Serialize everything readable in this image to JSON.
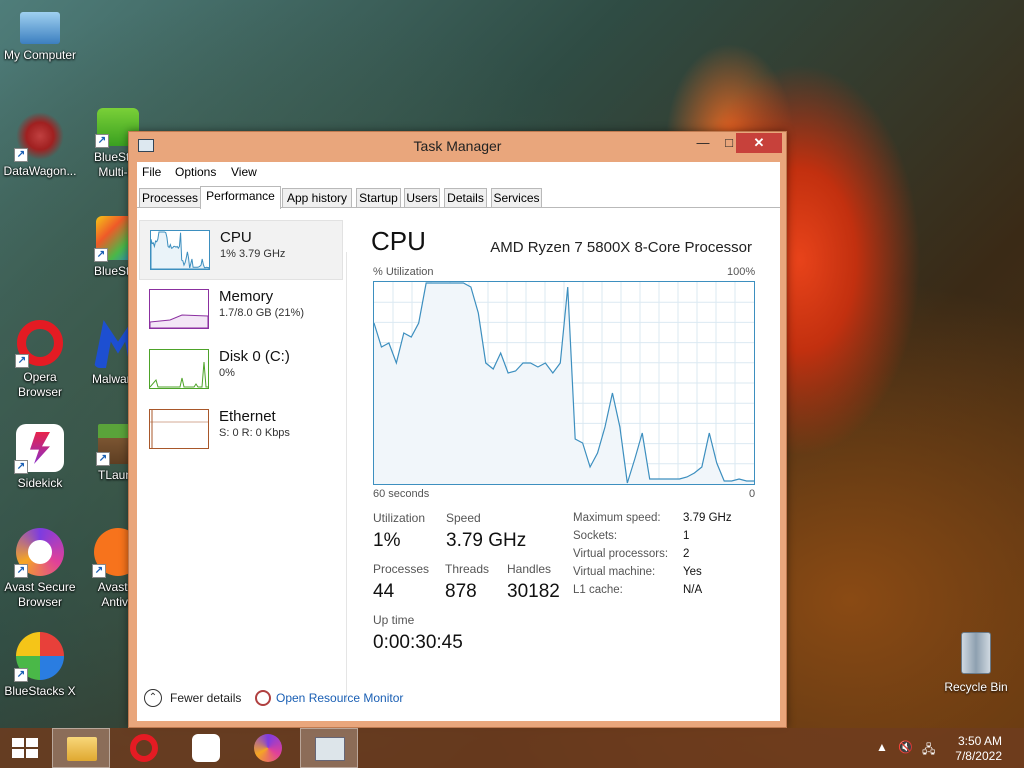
{
  "desktop": {
    "icons": [
      {
        "label1": "My Computer",
        "label2": ""
      },
      {
        "label1": "DataWagon...",
        "label2": ""
      },
      {
        "label1": "BlueStac",
        "label2": "Multi-In"
      },
      {
        "label1": "BlueStac",
        "label2": ""
      },
      {
        "label1": "Opera",
        "label2": "Browser"
      },
      {
        "label1": "Malwareb",
        "label2": ""
      },
      {
        "label1": "Sidekick",
        "label2": ""
      },
      {
        "label1": "TLaunc",
        "label2": ""
      },
      {
        "label1": "Avast Secure",
        "label2": "Browser"
      },
      {
        "label1": "Avast F",
        "label2": "Antivir"
      },
      {
        "label1": "BlueStacks X",
        "label2": ""
      },
      {
        "label1": "Recycle Bin",
        "label2": ""
      }
    ]
  },
  "window": {
    "title": "Task Manager",
    "min": "—",
    "max": "□",
    "close": "✕"
  },
  "menu": [
    "File",
    "Options",
    "View"
  ],
  "tabs": [
    "Processes",
    "Performance",
    "App history",
    "Startup",
    "Users",
    "Details",
    "Services"
  ],
  "sidebar": [
    {
      "name": "CPU",
      "sub": "1% 3.79 GHz",
      "color": "#3d8fbf"
    },
    {
      "name": "Memory",
      "sub": "1.7/8.0 GB (21%)",
      "color": "#8b2fa0"
    },
    {
      "name": "Disk 0 (C:)",
      "sub": "0%",
      "color": "#4da329"
    },
    {
      "name": "Ethernet",
      "sub": "S: 0 R: 0 Kbps",
      "color": "#a8572a"
    }
  ],
  "cpu": {
    "heading": "CPU",
    "model": "AMD Ryzen 7 5800X 8-Core Processor",
    "util_label": "% Utilization",
    "max_label": "100%",
    "time_label": "60 seconds",
    "zero_label": "0",
    "history": [
      80,
      68,
      70,
      60,
      75,
      73,
      80,
      100,
      100,
      100,
      100,
      100,
      100,
      98,
      85,
      60,
      57,
      65,
      55,
      56,
      60,
      60,
      58,
      60,
      55,
      60,
      98,
      22,
      20,
      8,
      15,
      28,
      45,
      28,
      0,
      12,
      25,
      2,
      2,
      2,
      2,
      2,
      3,
      5,
      8,
      25,
      10,
      1,
      1,
      2,
      1,
      1
    ],
    "stats": {
      "utilization_label": "Utilization",
      "utilization": "1%",
      "speed_label": "Speed",
      "speed": "3.79 GHz",
      "processes_label": "Processes",
      "processes": "44",
      "threads_label": "Threads",
      "threads": "878",
      "handles_label": "Handles",
      "handles": "30182",
      "uptime_label": "Up time",
      "uptime": "0:00:30:45"
    },
    "specs": [
      {
        "key": "Maximum speed:",
        "val": "3.79 GHz"
      },
      {
        "key": "Sockets:",
        "val": "1"
      },
      {
        "key": "Virtual processors:",
        "val": "2"
      },
      {
        "key": "Virtual machine:",
        "val": "Yes"
      },
      {
        "key": "L1 cache:",
        "val": "N/A"
      }
    ]
  },
  "footer": {
    "fewer_details": "Fewer details",
    "resource_monitor": "Open Resource Monitor"
  },
  "taskbar": {
    "time": "3:50 AM",
    "date": "7/8/2022"
  }
}
